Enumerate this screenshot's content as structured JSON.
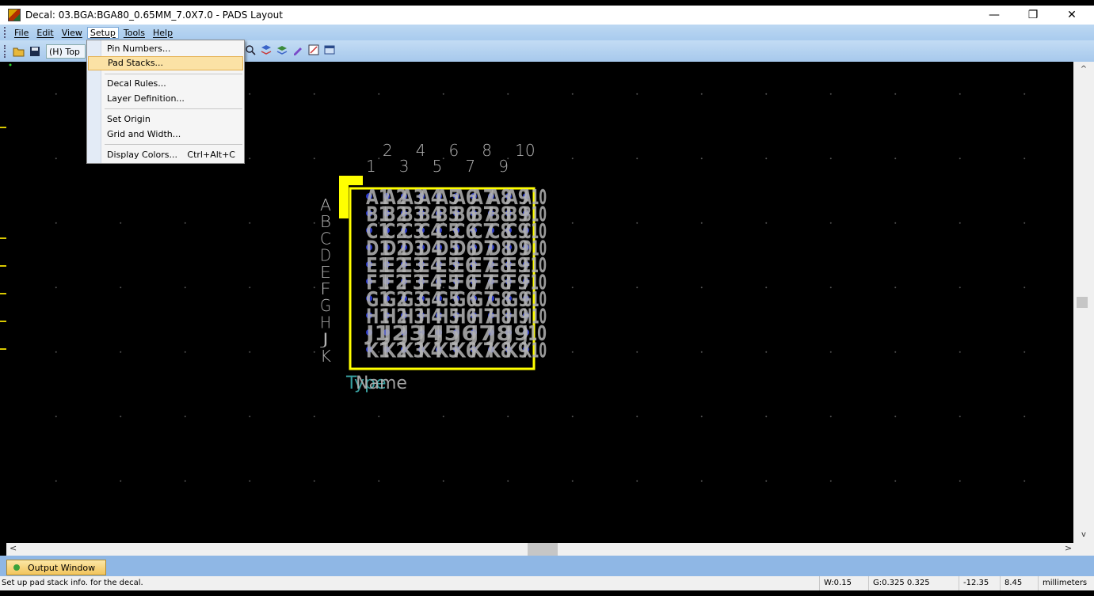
{
  "window": {
    "title": "Decal: 03.BGA:BGA80_0.65MM_7.0X7.0 - PADS Layout",
    "min": "—",
    "max": "❐",
    "close": "✕"
  },
  "menu": [
    "File",
    "Edit",
    "View",
    "Setup",
    "Tools",
    "Help"
  ],
  "toolbar": {
    "layer": "(H) Top"
  },
  "setup_menu": {
    "items": [
      "Pin Numbers...",
      "Pad Stacks...",
      "Decal Rules...",
      "Layer Definition...",
      "Set Origin",
      "Grid and Width...",
      "Display Colors..."
    ],
    "shortcut": "Ctrl+Alt+C",
    "highlighted": "Pad Stacks..."
  },
  "decal": {
    "columns": [
      "1",
      "2",
      "3",
      "4",
      "5",
      "6",
      "7",
      "8",
      "9",
      "10"
    ],
    "rows": [
      "A",
      "B",
      "C",
      "D",
      "E",
      "F",
      "G",
      "H",
      "J",
      "K"
    ],
    "type_label": "Type",
    "name_label": "Name",
    "colors": {
      "outline": "#ffff00",
      "pad": "#2a39c7",
      "text": "#b4b4b4",
      "label": "#3fb0b0"
    }
  },
  "output": {
    "tab": "Output Window"
  },
  "status": {
    "message": "Set up pad stack info. for the decal.",
    "width": "W:0.15",
    "grid": "G:0.325 0.325",
    "x": "-12.35",
    "y": "8.45",
    "units": "millimeters"
  }
}
